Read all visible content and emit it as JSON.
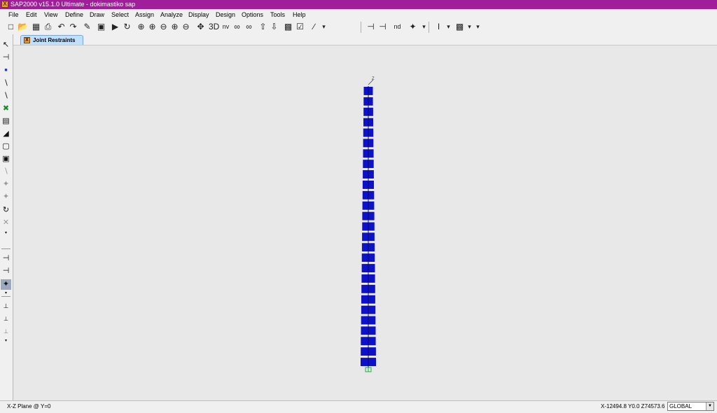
{
  "window": {
    "title": "SAP2000 v15.1.0 Ultimate  - dokimastiko sap",
    "app_icon": "sap-x-icon"
  },
  "menu": {
    "items": [
      "File",
      "Edit",
      "View",
      "Define",
      "Draw",
      "Select",
      "Assign",
      "Analyze",
      "Display",
      "Design",
      "Options",
      "Tools",
      "Help"
    ]
  },
  "toolbar": {
    "nv_label": "nv",
    "nd_label": "nd"
  },
  "tab": {
    "label": "Joint Restraints"
  },
  "canvas": {
    "axis_label": "Z"
  },
  "status": {
    "plane": "X-Z Plane @ Y=0",
    "coordinates": "X-12494.8  Y0.0  Z74573.6",
    "coord_system": "GLOBAL"
  },
  "colors": {
    "title_bar": "#a01e9a",
    "frame_members": "#0d12c8",
    "restraint": "#19b43b",
    "canvas_bg": "#e8e8e8"
  }
}
